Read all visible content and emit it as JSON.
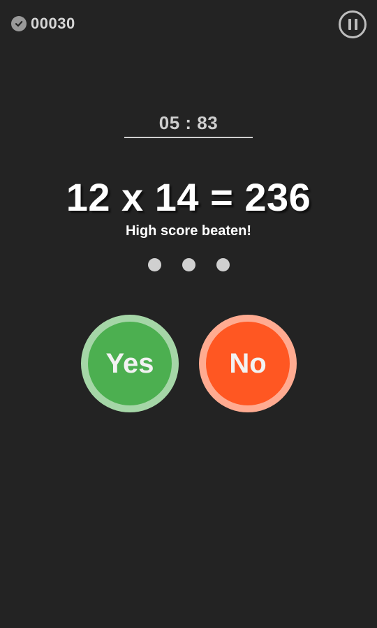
{
  "header": {
    "score": "00030",
    "score_icon": "check-icon",
    "pause_icon": "pause-icon"
  },
  "game": {
    "timer": "05 : 83",
    "equation": "12 x 14 = 236",
    "status": "High score beaten!",
    "progress_dots": 3
  },
  "answers": {
    "yes_label": "Yes",
    "no_label": "No"
  },
  "colors": {
    "background": "#232323",
    "yes": "#4caf50",
    "yes_ring": "#a5d6a7",
    "no": "#ff5722",
    "no_ring": "#ffab91"
  }
}
